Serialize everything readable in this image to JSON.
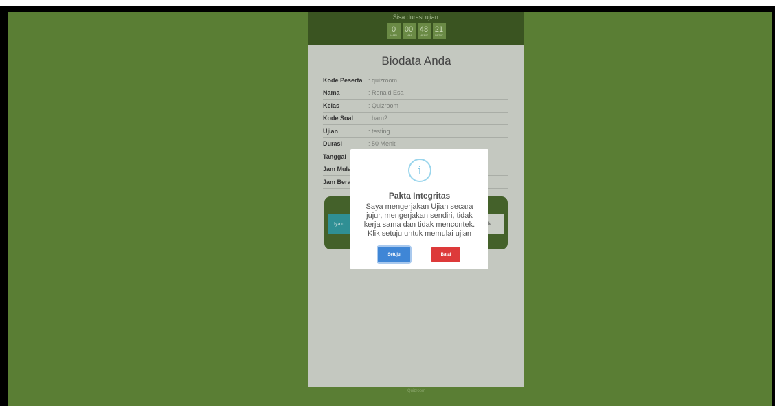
{
  "timer": {
    "label": "Sisa durasi ujian:",
    "units": [
      {
        "value": "0",
        "unit": "HARI"
      },
      {
        "value": "00",
        "unit": "JAM"
      },
      {
        "value": "48",
        "unit": "MENIT"
      },
      {
        "value": "21",
        "unit": "DETIK"
      }
    ]
  },
  "biodata": {
    "title": "Biodata Anda",
    "rows": [
      {
        "key": "Kode Peserta",
        "value": ": quizroom"
      },
      {
        "key": "Nama",
        "value": ": Ronald Esa"
      },
      {
        "key": "Kelas",
        "value": ": Quizroom"
      },
      {
        "key": "Kode Soal",
        "value": ": baru2"
      },
      {
        "key": "Ujian",
        "value": ": testing"
      },
      {
        "key": "Durasi",
        "value": ": 50 Menit"
      },
      {
        "key": "Tanggal",
        "value": ""
      },
      {
        "key": "Jam Mulai",
        "value": ""
      },
      {
        "key": "Jam Berakhir",
        "value": ""
      }
    ],
    "action_left": "Iya d",
    "action_right": "k"
  },
  "footer": "Quizroom",
  "modal": {
    "icon": "info-icon",
    "icon_glyph": "i",
    "title": "Pakta Integritas",
    "text": "Saya mengerjakan Ujian secara jujur, mengerjakan sendiri, tidak kerja sama dan tidak mencontek. Klik setuju untuk memulai ujian",
    "confirm_label": "Setuju",
    "cancel_label": "Batal"
  },
  "colors": {
    "background": "#5a7e34",
    "header": "#3a5421",
    "confirm": "#3f86d6",
    "cancel": "#dd3a3a"
  }
}
